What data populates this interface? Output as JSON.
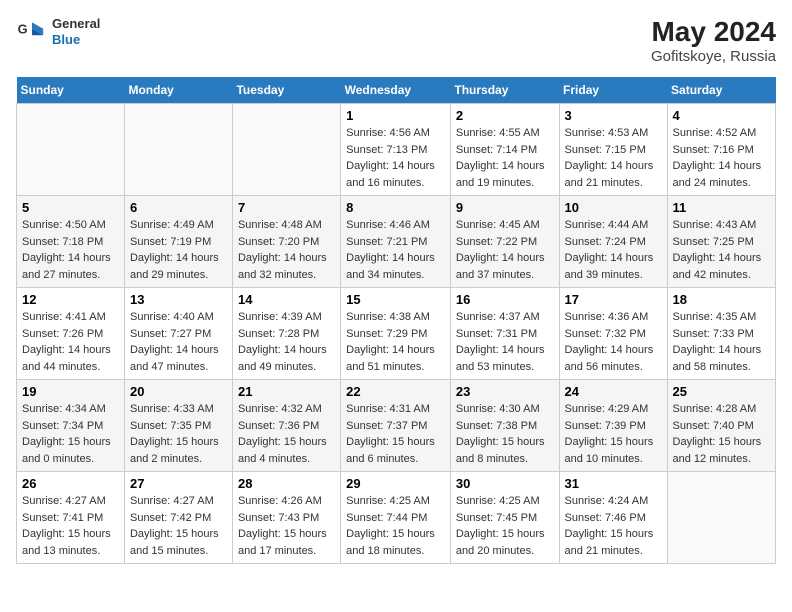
{
  "header": {
    "title": "May 2024",
    "location": "Gofitskoye, Russia",
    "logo_general": "General",
    "logo_blue": "Blue"
  },
  "days_of_week": [
    "Sunday",
    "Monday",
    "Tuesday",
    "Wednesday",
    "Thursday",
    "Friday",
    "Saturday"
  ],
  "weeks": [
    [
      {
        "day": "",
        "sunrise": "",
        "sunset": "",
        "daylight": ""
      },
      {
        "day": "",
        "sunrise": "",
        "sunset": "",
        "daylight": ""
      },
      {
        "day": "",
        "sunrise": "",
        "sunset": "",
        "daylight": ""
      },
      {
        "day": "1",
        "sunrise": "Sunrise: 4:56 AM",
        "sunset": "Sunset: 7:13 PM",
        "daylight": "Daylight: 14 hours and 16 minutes."
      },
      {
        "day": "2",
        "sunrise": "Sunrise: 4:55 AM",
        "sunset": "Sunset: 7:14 PM",
        "daylight": "Daylight: 14 hours and 19 minutes."
      },
      {
        "day": "3",
        "sunrise": "Sunrise: 4:53 AM",
        "sunset": "Sunset: 7:15 PM",
        "daylight": "Daylight: 14 hours and 21 minutes."
      },
      {
        "day": "4",
        "sunrise": "Sunrise: 4:52 AM",
        "sunset": "Sunset: 7:16 PM",
        "daylight": "Daylight: 14 hours and 24 minutes."
      }
    ],
    [
      {
        "day": "5",
        "sunrise": "Sunrise: 4:50 AM",
        "sunset": "Sunset: 7:18 PM",
        "daylight": "Daylight: 14 hours and 27 minutes."
      },
      {
        "day": "6",
        "sunrise": "Sunrise: 4:49 AM",
        "sunset": "Sunset: 7:19 PM",
        "daylight": "Daylight: 14 hours and 29 minutes."
      },
      {
        "day": "7",
        "sunrise": "Sunrise: 4:48 AM",
        "sunset": "Sunset: 7:20 PM",
        "daylight": "Daylight: 14 hours and 32 minutes."
      },
      {
        "day": "8",
        "sunrise": "Sunrise: 4:46 AM",
        "sunset": "Sunset: 7:21 PM",
        "daylight": "Daylight: 14 hours and 34 minutes."
      },
      {
        "day": "9",
        "sunrise": "Sunrise: 4:45 AM",
        "sunset": "Sunset: 7:22 PM",
        "daylight": "Daylight: 14 hours and 37 minutes."
      },
      {
        "day": "10",
        "sunrise": "Sunrise: 4:44 AM",
        "sunset": "Sunset: 7:24 PM",
        "daylight": "Daylight: 14 hours and 39 minutes."
      },
      {
        "day": "11",
        "sunrise": "Sunrise: 4:43 AM",
        "sunset": "Sunset: 7:25 PM",
        "daylight": "Daylight: 14 hours and 42 minutes."
      }
    ],
    [
      {
        "day": "12",
        "sunrise": "Sunrise: 4:41 AM",
        "sunset": "Sunset: 7:26 PM",
        "daylight": "Daylight: 14 hours and 44 minutes."
      },
      {
        "day": "13",
        "sunrise": "Sunrise: 4:40 AM",
        "sunset": "Sunset: 7:27 PM",
        "daylight": "Daylight: 14 hours and 47 minutes."
      },
      {
        "day": "14",
        "sunrise": "Sunrise: 4:39 AM",
        "sunset": "Sunset: 7:28 PM",
        "daylight": "Daylight: 14 hours and 49 minutes."
      },
      {
        "day": "15",
        "sunrise": "Sunrise: 4:38 AM",
        "sunset": "Sunset: 7:29 PM",
        "daylight": "Daylight: 14 hours and 51 minutes."
      },
      {
        "day": "16",
        "sunrise": "Sunrise: 4:37 AM",
        "sunset": "Sunset: 7:31 PM",
        "daylight": "Daylight: 14 hours and 53 minutes."
      },
      {
        "day": "17",
        "sunrise": "Sunrise: 4:36 AM",
        "sunset": "Sunset: 7:32 PM",
        "daylight": "Daylight: 14 hours and 56 minutes."
      },
      {
        "day": "18",
        "sunrise": "Sunrise: 4:35 AM",
        "sunset": "Sunset: 7:33 PM",
        "daylight": "Daylight: 14 hours and 58 minutes."
      }
    ],
    [
      {
        "day": "19",
        "sunrise": "Sunrise: 4:34 AM",
        "sunset": "Sunset: 7:34 PM",
        "daylight": "Daylight: 15 hours and 0 minutes."
      },
      {
        "day": "20",
        "sunrise": "Sunrise: 4:33 AM",
        "sunset": "Sunset: 7:35 PM",
        "daylight": "Daylight: 15 hours and 2 minutes."
      },
      {
        "day": "21",
        "sunrise": "Sunrise: 4:32 AM",
        "sunset": "Sunset: 7:36 PM",
        "daylight": "Daylight: 15 hours and 4 minutes."
      },
      {
        "day": "22",
        "sunrise": "Sunrise: 4:31 AM",
        "sunset": "Sunset: 7:37 PM",
        "daylight": "Daylight: 15 hours and 6 minutes."
      },
      {
        "day": "23",
        "sunrise": "Sunrise: 4:30 AM",
        "sunset": "Sunset: 7:38 PM",
        "daylight": "Daylight: 15 hours and 8 minutes."
      },
      {
        "day": "24",
        "sunrise": "Sunrise: 4:29 AM",
        "sunset": "Sunset: 7:39 PM",
        "daylight": "Daylight: 15 hours and 10 minutes."
      },
      {
        "day": "25",
        "sunrise": "Sunrise: 4:28 AM",
        "sunset": "Sunset: 7:40 PM",
        "daylight": "Daylight: 15 hours and 12 minutes."
      }
    ],
    [
      {
        "day": "26",
        "sunrise": "Sunrise: 4:27 AM",
        "sunset": "Sunset: 7:41 PM",
        "daylight": "Daylight: 15 hours and 13 minutes."
      },
      {
        "day": "27",
        "sunrise": "Sunrise: 4:27 AM",
        "sunset": "Sunset: 7:42 PM",
        "daylight": "Daylight: 15 hours and 15 minutes."
      },
      {
        "day": "28",
        "sunrise": "Sunrise: 4:26 AM",
        "sunset": "Sunset: 7:43 PM",
        "daylight": "Daylight: 15 hours and 17 minutes."
      },
      {
        "day": "29",
        "sunrise": "Sunrise: 4:25 AM",
        "sunset": "Sunset: 7:44 PM",
        "daylight": "Daylight: 15 hours and 18 minutes."
      },
      {
        "day": "30",
        "sunrise": "Sunrise: 4:25 AM",
        "sunset": "Sunset: 7:45 PM",
        "daylight": "Daylight: 15 hours and 20 minutes."
      },
      {
        "day": "31",
        "sunrise": "Sunrise: 4:24 AM",
        "sunset": "Sunset: 7:46 PM",
        "daylight": "Daylight: 15 hours and 21 minutes."
      },
      {
        "day": "",
        "sunrise": "",
        "sunset": "",
        "daylight": ""
      }
    ]
  ]
}
